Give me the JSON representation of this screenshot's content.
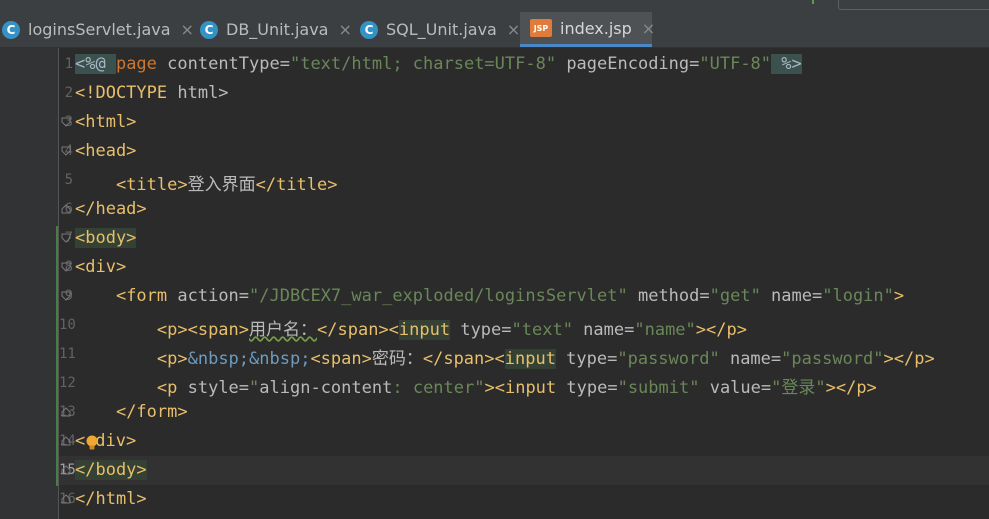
{
  "tabs": [
    {
      "label": "loginsServlet.java",
      "icon": "c-class-icon",
      "icon_text": "C"
    },
    {
      "label": "DB_Unit.java",
      "icon": "c-class-icon",
      "icon_text": "C"
    },
    {
      "label": "SQL_Unit.java",
      "icon": "c-class-icon",
      "icon_text": "C"
    },
    {
      "label": "index.jsp",
      "icon": "jsp-file-icon",
      "icon_text": "JSP",
      "active": true
    }
  ],
  "close_glyph": "×",
  "line_numbers": [
    "1",
    "2",
    "3",
    "4",
    "5",
    "6",
    "7",
    "8",
    "9",
    "10",
    "11",
    "12",
    "13",
    "14",
    "15",
    "16"
  ],
  "current_line": 15,
  "code": {
    "l1": {
      "a": "<%@ ",
      "b": "page",
      "c": " contentType=",
      "d": "\"text/html; charset=UTF-8\"",
      "e": " pageEncoding=",
      "f": "\"UTF-8\"",
      "g": " %>"
    },
    "l2": {
      "a": "<!DOCTYPE",
      "b": " html>"
    },
    "l3": {
      "a": "<html>"
    },
    "l4": {
      "a": "<head>"
    },
    "l5": {
      "indent": "    ",
      "a": "<title>",
      "b": "登入界面",
      "c": "</title>"
    },
    "l6": {
      "a": "</head>"
    },
    "l7": {
      "a": "<body>"
    },
    "l8": {
      "a": "<div>"
    },
    "l9": {
      "indent": "    ",
      "a": "<form",
      "b": " action=",
      "c": "\"/JDBCEX7_war_exploded/loginsServlet\"",
      "d": " method=",
      "e": "\"get\"",
      "f": " name=",
      "g": "\"login\"",
      "h": ">"
    },
    "l10": {
      "indent": "        ",
      "a": "<p><span>",
      "b": "用户名：",
      "c": "</span><",
      "d": "input",
      "e": " type=",
      "f": "\"text\"",
      "g": " name=",
      "h": "\"name\"",
      "i": "></p>"
    },
    "l11": {
      "indent": "        ",
      "a": "<p>",
      "b": "&nbsp;&nbsp;",
      "c": "<span>",
      "d": "密码：",
      "e": "</span><",
      "f": "input",
      "g": " type=",
      "h": "\"password\"",
      "i": " name=",
      "j": "\"password\"",
      "k": "></p>"
    },
    "l12": {
      "indent": "        ",
      "a": "<p",
      "b": " style=",
      "c": "\"",
      "d": "align-content",
      "e": ": ",
      "f": "center",
      "g": "\"",
      "h": "><input",
      "i": " type=",
      "j": "\"submit\"",
      "k": " value=",
      "l": "\"登录\"",
      "m": "></p>"
    },
    "l13": {
      "indent": "    ",
      "a": "</form>"
    },
    "l14": {
      "a": "<",
      "b": "div>"
    },
    "l15": {
      "a": "</body>"
    },
    "l16": {
      "a": "</html>"
    }
  },
  "colors": {
    "background": "#2b2b2b",
    "gutter": "#313335",
    "tag": "#e8bf6a",
    "attribute": "#bababa",
    "string": "#6a8759",
    "keyword": "#cc7832",
    "entity": "#6d9cbe",
    "active_tab_underline": "#4a88c7"
  }
}
